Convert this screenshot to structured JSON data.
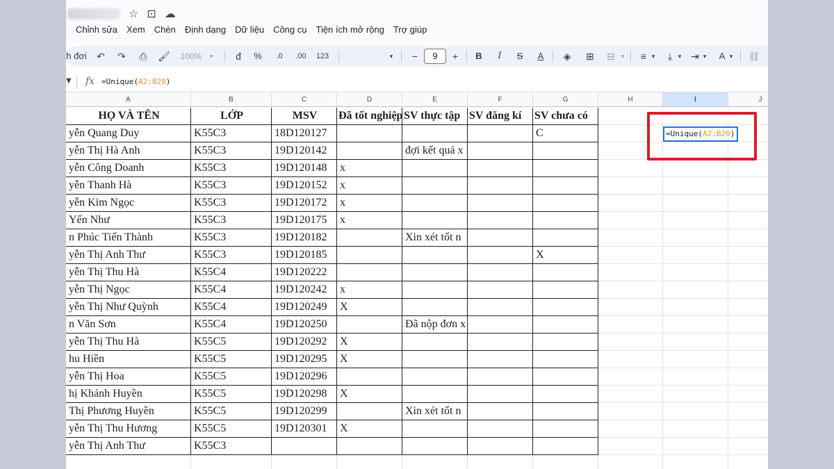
{
  "menu": [
    "Chỉnh sửa",
    "Xem",
    "Chèn",
    "Định dạng",
    "Dữ liệu",
    "Công cụ",
    "Tiện ích mở rộng",
    "Trợ giúp"
  ],
  "title_icons": [
    "star-icon",
    "move-folder-icon",
    "cloud-status-icon"
  ],
  "toolbar": {
    "mode_partial": "h đơi",
    "zoom": "100%",
    "currency": "đ",
    "percent": "%",
    "dec_decrease": ".0",
    "dec_increase": ".00",
    "number_format": "123",
    "font_size": "9",
    "minus": "−",
    "plus": "+",
    "bold": "B",
    "italic": "I",
    "strike": "S",
    "text_color": "A",
    "font_color_alt": "A"
  },
  "formula_bar": {
    "prefix": "=Unique(",
    "range": "A2:B20",
    "suffix": ")"
  },
  "columns": [
    "A",
    "B",
    "C",
    "D",
    "E",
    "F",
    "G",
    "H",
    "I",
    "J"
  ],
  "headers": [
    "HỌ VÀ TÊN",
    "LỚP",
    "MSV",
    "Đã tốt nghiệp",
    "SV thực tập",
    "SV đăng kí",
    "SV chưa có"
  ],
  "rows": [
    [
      "yễn Quang Duy",
      "K55C3",
      "18D120127",
      "",
      "",
      "",
      "C"
    ],
    [
      "yễn Thị Hà Anh",
      "K55C3",
      "19D120142",
      "",
      "đợi kết quả x",
      "",
      ""
    ],
    [
      "yễn Công Doanh",
      "K55C3",
      "19D120148",
      "x",
      "",
      "",
      ""
    ],
    [
      "yễn Thanh Hà",
      "K55C3",
      "19D120152",
      "x",
      "",
      "",
      ""
    ],
    [
      "yễn Kim Ngọc",
      "K55C3",
      "19D120172",
      "x",
      "",
      "",
      ""
    ],
    [
      "Yến Như",
      "K55C3",
      "19D120175",
      "x",
      "",
      "",
      ""
    ],
    [
      "n Phúc Tiến Thành",
      "K55C3",
      "19D120182",
      "",
      "Xin xét tốt n",
      "",
      ""
    ],
    [
      "yễn Thị Anh Thư",
      "K55C3",
      "19D120185",
      "",
      "",
      "",
      "X"
    ],
    [
      "yễn Thị Thu Hà",
      "K55C4",
      "19D120222",
      "",
      "",
      "",
      ""
    ],
    [
      "yễn Thị Ngọc",
      "K55C4",
      "19D120242",
      "x",
      "",
      "",
      ""
    ],
    [
      "yễn Thị Như Quỳnh",
      "K55C4",
      "19D120249",
      "X",
      "",
      "",
      ""
    ],
    [
      "n Văn Sơn",
      "K55C4",
      "19D120250",
      "",
      "Đã nộp đơn x",
      "",
      ""
    ],
    [
      "yễn Thị Thu Hà",
      "K55C5",
      "19D120292",
      "X",
      "",
      "",
      ""
    ],
    [
      "hu Hiền",
      "K55C5",
      "19D120295",
      "X",
      "",
      "",
      ""
    ],
    [
      "yễn Thị Hoa",
      "K55C5",
      "19D120296",
      "",
      "",
      "",
      ""
    ],
    [
      "hị Khánh Huyền",
      "K55C5",
      "19D120298",
      "X",
      "",
      "",
      ""
    ],
    [
      "Thị Phương Huyền",
      "K55C5",
      "19D120299",
      "",
      "Xin xét tốt n",
      "",
      ""
    ],
    [
      "yễn Thị Thu Hương",
      "K55C5",
      "19D120301",
      "X",
      "",
      "",
      ""
    ],
    [
      "yễn Thị Anh Thư",
      "K55C3",
      "",
      "",
      "",
      "",
      ""
    ]
  ],
  "active_cell": {
    "prefix": "=Unique(",
    "range": "A2:B20",
    "suffix": ")"
  },
  "colors": {
    "highlight": "#d3202a",
    "selection": "#1a73e8",
    "range_ref": "#e49a23"
  }
}
